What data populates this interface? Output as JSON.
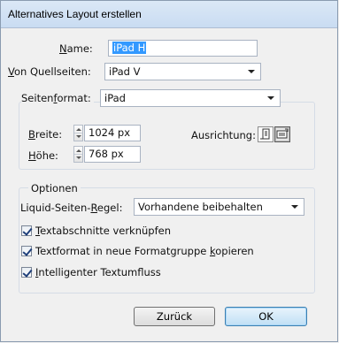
{
  "window": {
    "title": "Alternatives Layout erstellen"
  },
  "name": {
    "label_mn": "N",
    "label_rest": "ame:",
    "value": "iPad H"
  },
  "source": {
    "label_mn": "V",
    "label_rest": "on Quellseiten:",
    "value": "iPad V"
  },
  "page_format": {
    "label_pre": "Seiten",
    "label_mn": "f",
    "label_rest": "ormat:",
    "value": "iPad",
    "width": {
      "label_mn": "B",
      "label_rest": "reite:",
      "value": "1024 px"
    },
    "height": {
      "label_mn": "H",
      "label_rest": "öhe:",
      "value": "768 px"
    },
    "orientation_label": "Ausrichtung:",
    "orientation_icons": [
      "portrait-icon",
      "landscape-icon"
    ]
  },
  "options": {
    "label": "Optionen",
    "liquid_rule": {
      "label_pre": "Liquid-Seiten-",
      "label_mn": "R",
      "label_rest": "egel:",
      "value": "Vorhandene beibehalten"
    },
    "checkboxes": [
      {
        "mn": "T",
        "rest": "extabschnitte verknüpfen",
        "checked": true
      },
      {
        "pre": "Textformat in neue Formatgruppe ",
        "mn": "k",
        "rest": "opieren",
        "checked": true
      },
      {
        "mn": "I",
        "rest": "ntelligenter Textumfluss",
        "checked": true
      }
    ]
  },
  "buttons": {
    "back": "Zurück",
    "ok": "OK"
  }
}
